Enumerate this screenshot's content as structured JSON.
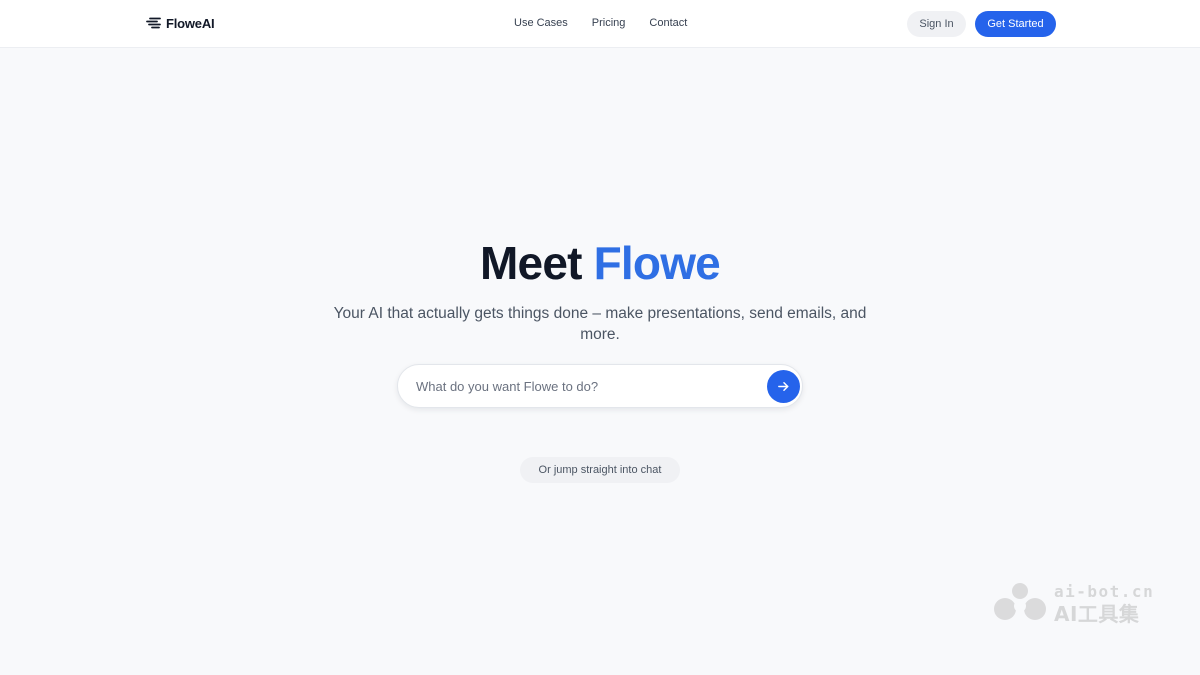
{
  "header": {
    "brand": "FloweAI",
    "brand_icon": "speed-lines-icon",
    "nav": [
      {
        "label": "Use Cases"
      },
      {
        "label": "Pricing"
      },
      {
        "label": "Contact"
      }
    ],
    "sign_in_label": "Sign In",
    "get_started_label": "Get Started"
  },
  "hero": {
    "title_prefix": "Meet",
    "title_accent": "Flowe",
    "subtitle": "Your AI that actually gets things done – make presentations, send emails, and more.",
    "prompt_placeholder": "What do you want Flowe to do?",
    "prompt_value": "",
    "submit_icon": "arrow-right-icon",
    "jump_chat_label": "Or jump straight into chat"
  },
  "watermark": {
    "domain": "ai-bot.cn",
    "text": "AI工具集"
  },
  "colors": {
    "accent": "#2563eb",
    "title_accent": "#2f6fe4",
    "page_background": "#f8f9fb",
    "header_background": "#ffffff",
    "text_primary": "#111827",
    "text_secondary": "#4b5563",
    "pill_background": "#f0f1f4"
  }
}
